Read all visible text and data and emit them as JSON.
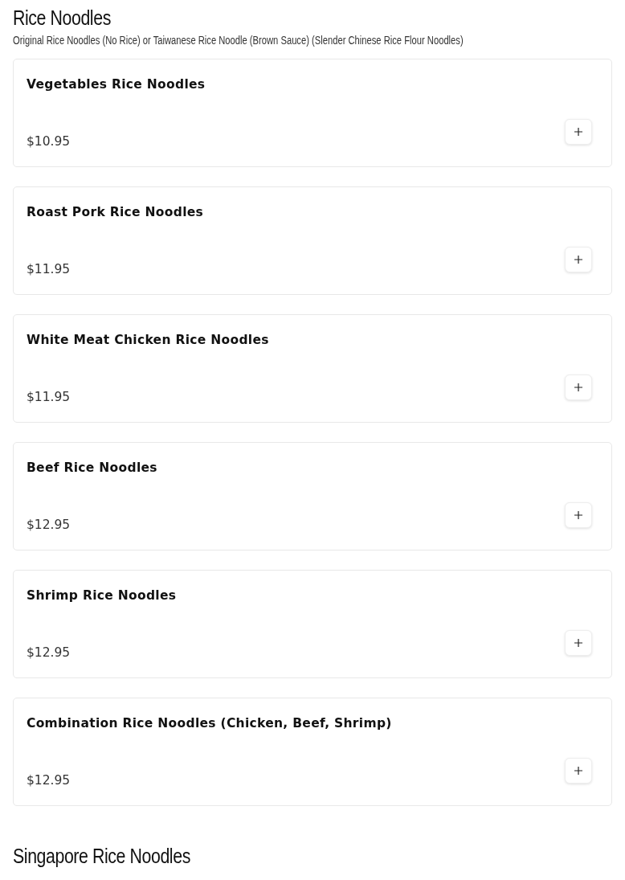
{
  "section": {
    "title": "Rice Noodles",
    "description": "Original Rice Noodles (No Rice) or Taiwanese Rice Noodle (Brown Sauce) (Slender Chinese Rice Flour Noodles)"
  },
  "items": [
    {
      "name": "Vegetables Rice Noodles",
      "price": "$10.95"
    },
    {
      "name": "Roast Pork Rice Noodles",
      "price": "$11.95"
    },
    {
      "name": "White Meat Chicken Rice Noodles",
      "price": "$11.95"
    },
    {
      "name": "Beef Rice Noodles",
      "price": "$12.95"
    },
    {
      "name": "Shrimp Rice Noodles",
      "price": "$12.95"
    },
    {
      "name": "Combination Rice Noodles (Chicken, Beef, Shrimp)",
      "price": "$12.95"
    }
  ],
  "next_section": {
    "title": "Singapore Rice Noodles"
  }
}
